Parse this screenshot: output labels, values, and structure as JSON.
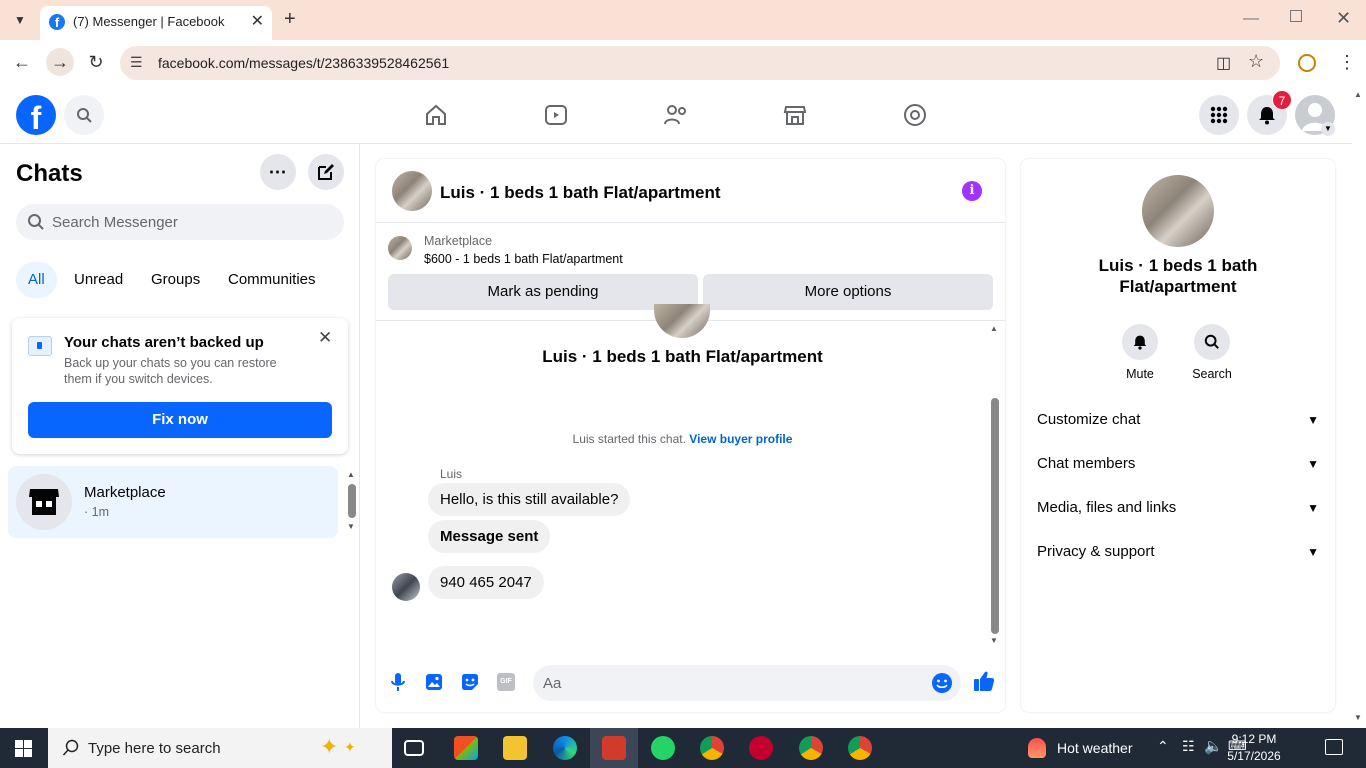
{
  "browser": {
    "tab_title": "(7) Messenger | Facebook",
    "url": "facebook.com/messages/t/2386339528462561"
  },
  "header": {
    "notification_count": "7"
  },
  "sidebar": {
    "title": "Chats",
    "search_placeholder": "Search Messenger",
    "filters": [
      "All",
      "Unread",
      "Groups",
      "Communities"
    ],
    "backup_title": "Your chats aren’t backed up",
    "backup_desc": "Back up your chats so you can restore them if you switch devices.",
    "fix_label": "Fix now",
    "conversation": {
      "name": "Marketplace",
      "time": "· 1m"
    }
  },
  "chat": {
    "title": "Luis · 1 beds 1 bath Flat/apartment",
    "marketplace_label": "Marketplace",
    "listing": "$600 - 1 beds 1 bath Flat/apartment",
    "mark_pending": "Mark as pending",
    "more_options": "More options",
    "thread_title": "Luis · 1 beds 1 bath Flat/apartment",
    "started_text": "Luis started this chat.",
    "view_profile": "View buyer profile",
    "sender": "Luis",
    "messages": [
      "Hello, is this still available?",
      "Message sent",
      "940 465 2047"
    ],
    "input_placeholder": "Aa"
  },
  "details": {
    "name": "Luis · 1 beds 1 bath Flat/apartment",
    "mute": "Mute",
    "search": "Search",
    "sections": [
      "Customize chat",
      "Chat members",
      "Media, files and links",
      "Privacy & support"
    ]
  },
  "taskbar": {
    "search_placeholder": "Type here to search",
    "weather": "Hot weather",
    "time": "9:12 PM",
    "date": "5/17/2026"
  }
}
